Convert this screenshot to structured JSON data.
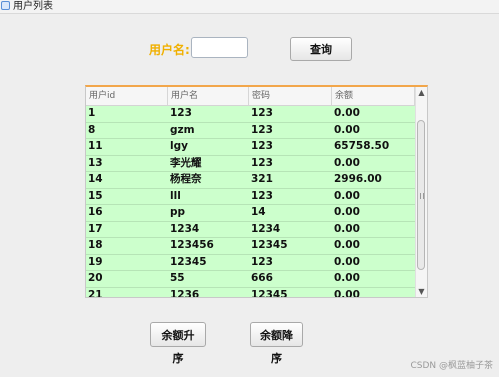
{
  "window": {
    "title": "用户列表"
  },
  "search": {
    "label": "用户名:",
    "value": "",
    "placeholder": "",
    "button": "查询"
  },
  "table": {
    "columns": [
      "用户id",
      "用户名",
      "密码",
      "余额"
    ],
    "rows": [
      [
        "1",
        "123",
        "123",
        "0.00"
      ],
      [
        "8",
        "gzm",
        "123",
        "0.00"
      ],
      [
        "11",
        "lgy",
        "123",
        "65758.50"
      ],
      [
        "13",
        "李光耀",
        "123",
        "0.00"
      ],
      [
        "14",
        "杨程奈",
        "321",
        "2996.00"
      ],
      [
        "15",
        "lll",
        "123",
        "0.00"
      ],
      [
        "16",
        "pp",
        "14",
        "0.00"
      ],
      [
        "17",
        "1234",
        "1234",
        "0.00"
      ],
      [
        "18",
        "123456",
        "12345",
        "0.00"
      ],
      [
        "19",
        "12345",
        "123",
        "0.00"
      ],
      [
        "20",
        "55",
        "666",
        "0.00"
      ],
      [
        "21",
        "1236",
        "12345",
        "0.00"
      ]
    ]
  },
  "actions": {
    "sort_asc": "余额升序",
    "sort_desc": "余额降序"
  },
  "watermark": "CSDN @枫蓝柚子茶"
}
